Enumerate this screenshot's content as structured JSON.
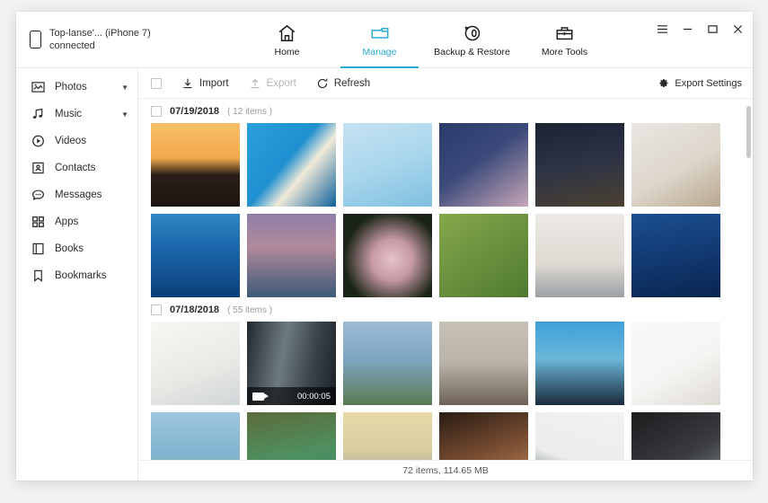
{
  "window": {
    "device_name": "Top-lanse'... (iPhone 7)",
    "device_status": "connected",
    "controls": {
      "menu": "☰",
      "minimize": "–",
      "maximize": "☐",
      "close": "✕"
    }
  },
  "nav": {
    "items": [
      {
        "label": "Home",
        "icon": "home-icon",
        "active": false
      },
      {
        "label": "Manage",
        "icon": "folder-icon",
        "active": true
      },
      {
        "label": "Backup & Restore",
        "icon": "backup-restore-icon",
        "active": false
      },
      {
        "label": "More Tools",
        "icon": "toolbox-icon",
        "active": false
      }
    ],
    "accent_color": "#29abd4"
  },
  "sidebar": {
    "items": [
      {
        "label": "Photos",
        "icon": "photo-icon",
        "expandable": true
      },
      {
        "label": "Music",
        "icon": "music-note-icon",
        "expandable": true
      },
      {
        "label": "Videos",
        "icon": "play-circle-icon",
        "expandable": false
      },
      {
        "label": "Contacts",
        "icon": "contact-card-icon",
        "expandable": false
      },
      {
        "label": "Messages",
        "icon": "message-bubble-icon",
        "expandable": false
      },
      {
        "label": "Apps",
        "icon": "grid-apps-icon",
        "expandable": false
      },
      {
        "label": "Books",
        "icon": "book-icon",
        "expandable": false
      },
      {
        "label": "Bookmarks",
        "icon": "bookmark-icon",
        "expandable": false
      }
    ]
  },
  "toolbar": {
    "select_all_checked": false,
    "import_label": "Import",
    "export_label": "Export",
    "export_disabled": true,
    "refresh_label": "Refresh",
    "export_settings_label": "Export Settings"
  },
  "groups": [
    {
      "date": "07/19/2018",
      "count_label": "( 12 items )",
      "checked": false,
      "thumbs": [
        {
          "name": "sunset-coast-photo",
          "c1": "#f2a84b",
          "c2": "#2a1f1a",
          "type": "image"
        },
        {
          "name": "pool-sunbather-photo",
          "c1": "#1f8fd0",
          "c2": "#0d5f9b",
          "type": "image"
        },
        {
          "name": "pool-aerial-photo",
          "c1": "#a9d6ec",
          "c2": "#7fc0e0",
          "type": "image"
        },
        {
          "name": "cherry-blossom-photo",
          "c1": "#2a3a6b",
          "c2": "#c9a7b8",
          "type": "image"
        },
        {
          "name": "night-alley-photo",
          "c1": "#1b2233",
          "c2": "#4a4030",
          "type": "image"
        },
        {
          "name": "deer-snow-photo",
          "c1": "#e9e6e2",
          "c2": "#b8a78e",
          "type": "image"
        },
        {
          "name": "beluga-whale-photo",
          "c1": "#1a63a8",
          "c2": "#0b3f78",
          "type": "image"
        },
        {
          "name": "dusk-bay-photo",
          "c1": "#8f7fa8",
          "c2": "#3c5a78",
          "type": "image"
        },
        {
          "name": "flower-dark-photo",
          "c1": "#1a2418",
          "c2": "#e4c2c8",
          "type": "image"
        },
        {
          "name": "rice-terrace-photo",
          "c1": "#4f7a2e",
          "c2": "#86a84c",
          "type": "image"
        },
        {
          "name": "washing-hands-photo",
          "c1": "#eceae6",
          "c2": "#9aa0a4",
          "type": "image"
        },
        {
          "name": "ocean-waves-photo",
          "c1": "#123a73",
          "c2": "#0a2550",
          "type": "image"
        }
      ]
    },
    {
      "date": "07/18/2018",
      "count_label": "( 55 items )",
      "checked": false,
      "thumbs": [
        {
          "name": "living-room-photo",
          "c1": "#f4f2ee",
          "c2": "#cfd6d8",
          "type": "image"
        },
        {
          "name": "city-building-video",
          "c1": "#6e7a82",
          "c2": "#20282e",
          "type": "video",
          "duration": "00:00:05"
        },
        {
          "name": "lake-mountain-photo",
          "c1": "#9dbcd4",
          "c2": "#5a7a52",
          "type": "image"
        },
        {
          "name": "vatican-square-photo",
          "c1": "#b9b2a6",
          "c2": "#6e6257",
          "type": "image"
        },
        {
          "name": "jumping-silhouette-photo",
          "c1": "#3ea0d8",
          "c2": "#1a2a3a",
          "type": "image"
        },
        {
          "name": "white-tshirt-photo",
          "c1": "#f6f5f3",
          "c2": "#dedad4",
          "type": "image"
        },
        {
          "name": "beach-boats-photo",
          "c1": "#9ec6dd",
          "c2": "#dcc9a8",
          "type": "image"
        },
        {
          "name": "lagoon-cliffs-photo",
          "c1": "#2f8f6f",
          "c2": "#5c6b3a",
          "type": "image"
        },
        {
          "name": "beach-sunset-couple-photo",
          "c1": "#e8d9a8",
          "c2": "#7f93a8",
          "type": "image"
        },
        {
          "name": "family-portrait-photo",
          "c1": "#2a1c14",
          "c2": "#c98f62",
          "type": "image"
        },
        {
          "name": "pendant-lamp-photo",
          "c1": "#f3f2f0",
          "c2": "#3f5a63",
          "type": "image"
        },
        {
          "name": "cat-held-photo",
          "c1": "#1c1c1e",
          "c2": "#8a8f94",
          "type": "image"
        }
      ]
    }
  ],
  "status": {
    "summary": "72 items, 114.65 MB"
  }
}
